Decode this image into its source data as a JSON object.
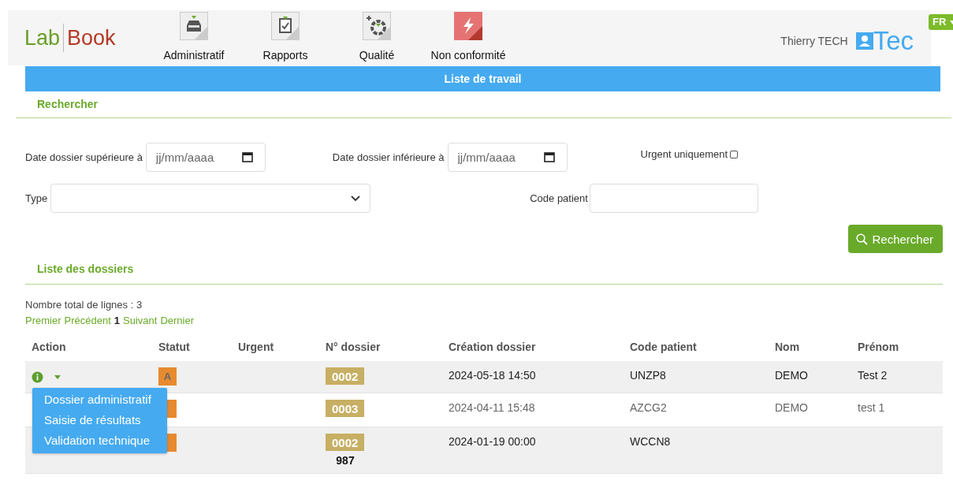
{
  "header": {
    "logo": {
      "left": "Lab",
      "right": "Book"
    },
    "nav": [
      {
        "label": "Administratif",
        "kind": "inbox"
      },
      {
        "label": "Rapports",
        "kind": "clipboard"
      },
      {
        "label": "Qualité",
        "kind": "quality"
      },
      {
        "label": "Non conformité",
        "kind": "alert"
      }
    ],
    "user": "Thierry TECH",
    "brand": "Tec",
    "language": "FR"
  },
  "title": "Liste de travail",
  "search": {
    "heading": "Rechercher",
    "date_from": {
      "label": "Date dossier supérieure à",
      "placeholder": "jj/mm/aaaa"
    },
    "date_to": {
      "label": "Date dossier inférieure à",
      "placeholder": "jj/mm/aaaa"
    },
    "urgent": {
      "label": "Urgent uniquement",
      "checked": false
    },
    "type": {
      "label": "Type"
    },
    "patient_code": {
      "label": "Code patient"
    },
    "button": "Rechercher"
  },
  "list": {
    "heading": "Liste des dossiers",
    "total": "Nombre total de lignes : 3",
    "pagination": [
      {
        "label": "Premier",
        "selected": false
      },
      {
        "label": "Précédent",
        "selected": false
      },
      {
        "label": "1",
        "selected": true
      },
      {
        "label": "Suivant",
        "selected": false
      },
      {
        "label": "Dernier",
        "selected": false
      }
    ],
    "columns": [
      "Action",
      "Statut",
      "Urgent",
      "N° dossier",
      "Création dossier",
      "Code patient",
      "Nom",
      "Prénom"
    ],
    "rows": [
      {
        "status": "A",
        "dossier": "0002",
        "creation": "2024-05-18 14:50",
        "patient_code": "UNZP8",
        "nom": "DEMO",
        "prenom": "Test 2",
        "muted": false,
        "action_menu": [
          "Dossier administratif",
          "Saisie de résultats",
          "Validation technique"
        ]
      },
      {
        "dossier": "0003",
        "creation": "2024-04-11 15:48",
        "patient_code": "AZCG2",
        "nom": "DEMO",
        "prenom": "test 1",
        "muted": true
      },
      {
        "dossier": "0002",
        "dossier_extra": "987",
        "creation": "2024-01-19 00:00",
        "patient_code": "WCCN8",
        "muted": false
      }
    ]
  }
}
